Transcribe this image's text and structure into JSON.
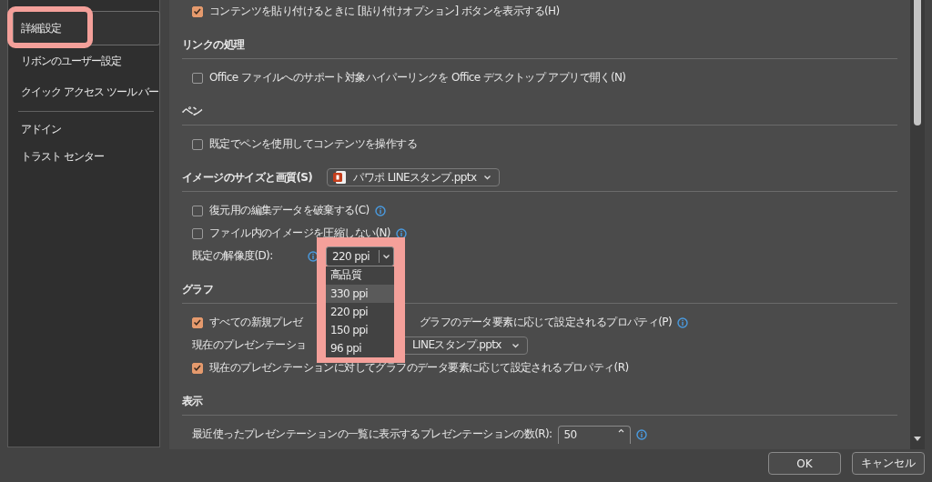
{
  "sidebar": {
    "groups": [
      {
        "items": [
          {
            "label": "詳細設定",
            "selected": true
          },
          {
            "label": "リボンのユーザー設定",
            "selected": false
          },
          {
            "label": "クイック アクセス ツール バー",
            "selected": false
          }
        ]
      },
      {
        "items": [
          {
            "label": "アドイン",
            "selected": false
          },
          {
            "label": "トラスト センター",
            "selected": false
          }
        ]
      }
    ]
  },
  "sections": [
    {
      "rows": [
        {
          "kind": "check",
          "checked": true,
          "text": "コンテンツを貼り付けるときに [貼り付けオプション] ボタンを表示する(H)"
        }
      ]
    },
    {
      "heading": "リンクの処理",
      "rows": [
        {
          "kind": "check",
          "checked": false,
          "text": "Office ファイルへのサポート対象ハイパーリンクを Office デスクトップ アプリで開く(N)"
        }
      ]
    },
    {
      "heading": "ペン",
      "rows": [
        {
          "kind": "check",
          "checked": false,
          "text": "既定でペンを使用してコンテンツを操作する"
        }
      ]
    },
    {
      "heading": "イメージのサイズと画質(S)",
      "heading_dropdown": {
        "value": "パワポ LINEスタンプ.pptx"
      },
      "rows": [
        {
          "kind": "check",
          "checked": false,
          "text": "復元用の編集データを破棄する(C)",
          "info": true
        },
        {
          "kind": "check",
          "checked": false,
          "text": "ファイル内のイメージを圧縮しない(N)",
          "info": true
        },
        {
          "kind": "select",
          "label": "既定の解像度(D):",
          "info": true,
          "value": "220 ppi",
          "expanded": true,
          "options": [
            {
              "kind": "group",
              "label": "高品質"
            },
            {
              "kind": "option",
              "label": "330 ppi",
              "highlighted": true
            },
            {
              "kind": "option",
              "label": "220 ppi",
              "highlighted": false
            },
            {
              "kind": "option",
              "label": "150 ppi",
              "highlighted": false
            },
            {
              "kind": "option",
              "label": "96 ppi",
              "highlighted": false
            }
          ]
        }
      ]
    },
    {
      "heading": "グラフ",
      "rows": [
        {
          "kind": "check",
          "checked": true,
          "text": "すべての新規プレゼ",
          "text_after": "グラフのデータ要素に応じて設定されるプロパティ(P)",
          "info": true
        },
        {
          "kind": "dropdown",
          "label": "現在のプレゼンテーショ",
          "value": "LINEスタンプ.pptx"
        },
        {
          "kind": "check",
          "checked": true,
          "text": "現在のプレゼンテーションに対してグラフのデータ要素に応じて設定されるプロパティ(R)"
        }
      ]
    },
    {
      "heading": "表示",
      "rows": [
        {
          "kind": "number",
          "label": "最近使ったプレゼンテーションの一覧に表示するプレゼンテーションの数(R):",
          "value": "50",
          "info": true
        }
      ]
    }
  ],
  "buttons": [
    "OK",
    "キャンセル"
  ]
}
